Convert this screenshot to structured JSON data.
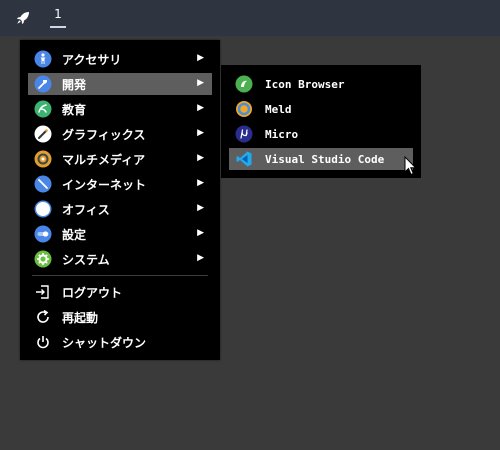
{
  "taskbar": {
    "workspace_label": "1"
  },
  "menu": {
    "items": [
      {
        "label": "アクセサリ",
        "icon": "accessories-icon"
      },
      {
        "label": "開発",
        "icon": "development-icon"
      },
      {
        "label": "教育",
        "icon": "education-icon"
      },
      {
        "label": "グラフィックス",
        "icon": "graphics-icon"
      },
      {
        "label": "マルチメディア",
        "icon": "multimedia-icon"
      },
      {
        "label": "インターネット",
        "icon": "internet-icon"
      },
      {
        "label": "オフィス",
        "icon": "office-icon"
      },
      {
        "label": "設定",
        "icon": "settings-icon"
      },
      {
        "label": "システム",
        "icon": "system-icon"
      }
    ],
    "actions": [
      {
        "label": "ログアウト",
        "icon": "logout-icon"
      },
      {
        "label": "再起動",
        "icon": "restart-icon"
      },
      {
        "label": "シャットダウン",
        "icon": "shutdown-icon"
      }
    ],
    "selected": "開発"
  },
  "submenu": {
    "items": [
      {
        "label": "Icon Browser",
        "icon": "icon-browser-icon"
      },
      {
        "label": "Meld",
        "icon": "meld-icon"
      },
      {
        "label": "Micro",
        "icon": "micro-icon"
      },
      {
        "label": "Visual Studio Code",
        "icon": "vscode-icon"
      }
    ],
    "selected": "Visual Studio Code"
  },
  "colors": {
    "desktop": "#3a3a3a",
    "taskbar": "#2e3440",
    "menu_bg": "#000000",
    "highlight": "#5e5e5e"
  }
}
